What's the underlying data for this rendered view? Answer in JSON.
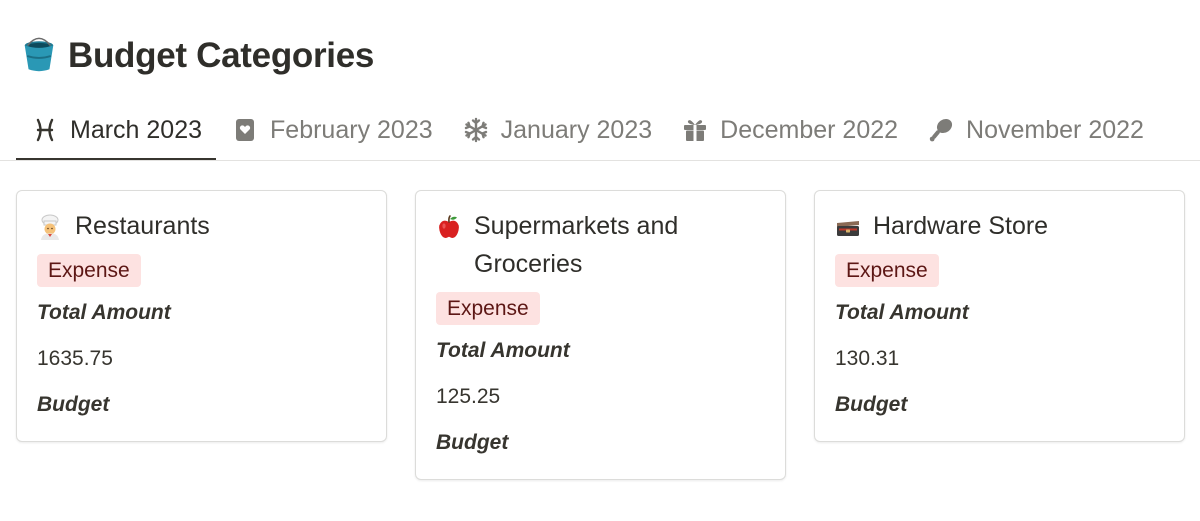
{
  "page": {
    "title": "Budget Categories",
    "title_icon": "bucket-icon"
  },
  "tabs": [
    {
      "label": "March 2023",
      "icon": "pisces-icon",
      "active": true
    },
    {
      "label": "February 2023",
      "icon": "heart-card-icon",
      "active": false
    },
    {
      "label": "January 2023",
      "icon": "snowflake-icon",
      "active": false
    },
    {
      "label": "December 2022",
      "icon": "gift-icon",
      "active": false
    },
    {
      "label": "November 2022",
      "icon": "drumstick-icon",
      "active": false
    }
  ],
  "cards": [
    {
      "title": "Restaurants",
      "icon": "chef-icon",
      "tag": "Expense",
      "total_label": "Total Amount",
      "total_value": "1635.75",
      "budget_label": "Budget",
      "budget_value": ""
    },
    {
      "title": "Supermarkets and Groceries",
      "icon": "apple-icon",
      "tag": "Expense",
      "total_label": "Total Amount",
      "total_value": "125.25",
      "budget_label": "Budget",
      "budget_value": ""
    },
    {
      "title": "Hardware Store",
      "icon": "toolbox-icon",
      "tag": "Expense",
      "total_label": "Total Amount",
      "total_value": "130.31",
      "budget_label": "Budget",
      "budget_value": ""
    }
  ],
  "colors": {
    "text": "#37352f",
    "muted": "#7d7c78",
    "tag_bg": "#fde2e1",
    "tag_text": "#5d1715",
    "border": "#dcdcda"
  }
}
